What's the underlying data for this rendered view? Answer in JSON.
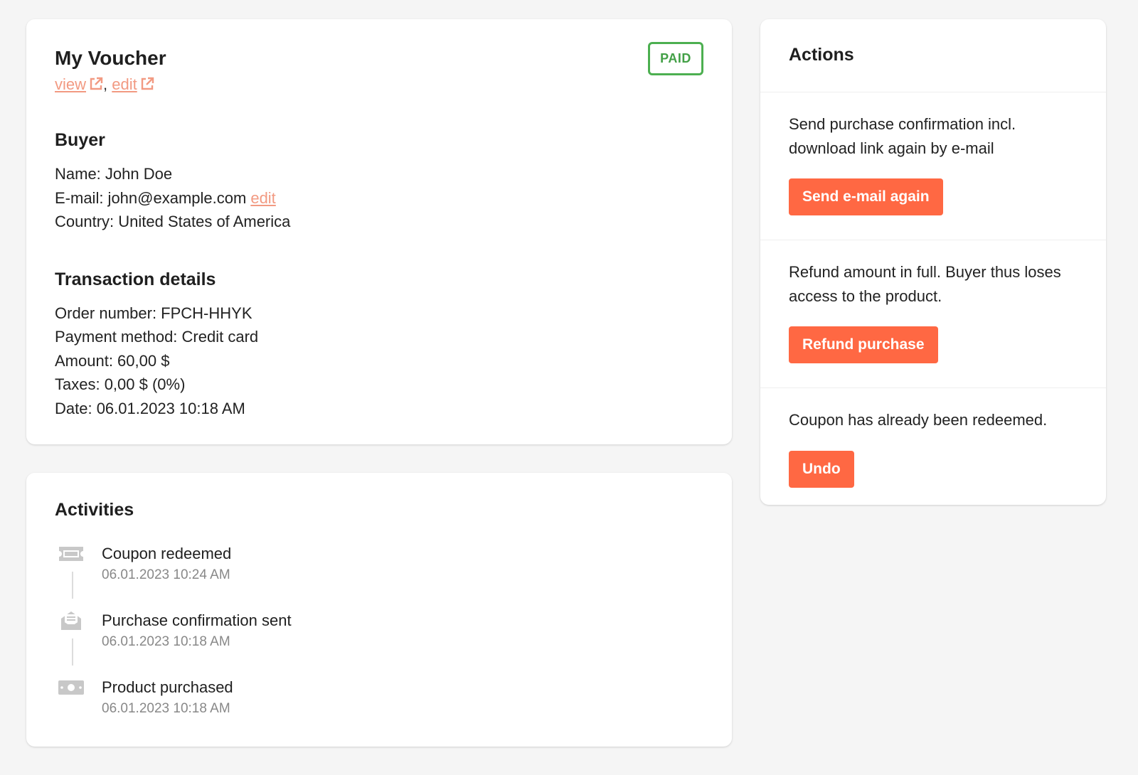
{
  "voucher": {
    "title": "My Voucher",
    "view_label": "view",
    "edit_label": "edit",
    "separator": ",",
    "status": "PAID"
  },
  "buyer": {
    "heading": "Buyer",
    "name": "Name: John Doe",
    "email": "E-mail: john@example.com",
    "email_edit_label": "edit",
    "country": "Country: United States of America"
  },
  "transaction": {
    "heading": "Transaction details",
    "order": "Order number: FPCH-HHYK",
    "payment": "Payment method: Credit card",
    "amount": "Amount: 60,00 $",
    "taxes": "Taxes: 0,00 $ (0%)",
    "date": "Date: 06.01.2023 10:18 AM"
  },
  "activities": {
    "heading": "Activities",
    "items": [
      {
        "label": "Coupon redeemed",
        "date": "06.01.2023 10:24 AM",
        "icon": "ticket-icon"
      },
      {
        "label": "Purchase confirmation sent",
        "date": "06.01.2023 10:18 AM",
        "icon": "envelope-open-icon"
      },
      {
        "label": "Product purchased",
        "date": "06.01.2023 10:18 AM",
        "icon": "money-bill-icon"
      }
    ]
  },
  "actions": {
    "heading": "Actions",
    "items": [
      {
        "text": "Send purchase confirmation incl. download link again by e-mail",
        "button": "Send e-mail again"
      },
      {
        "text": "Refund amount in full. Buyer thus loses access to the product.",
        "button": "Refund purchase"
      },
      {
        "text": "Coupon has already been redeemed.",
        "button": "Undo"
      }
    ]
  },
  "colors": {
    "accent": "#ff6843",
    "link": "#f29a82",
    "paid": "#4caf50",
    "icon_gray": "#c8c8c8"
  }
}
